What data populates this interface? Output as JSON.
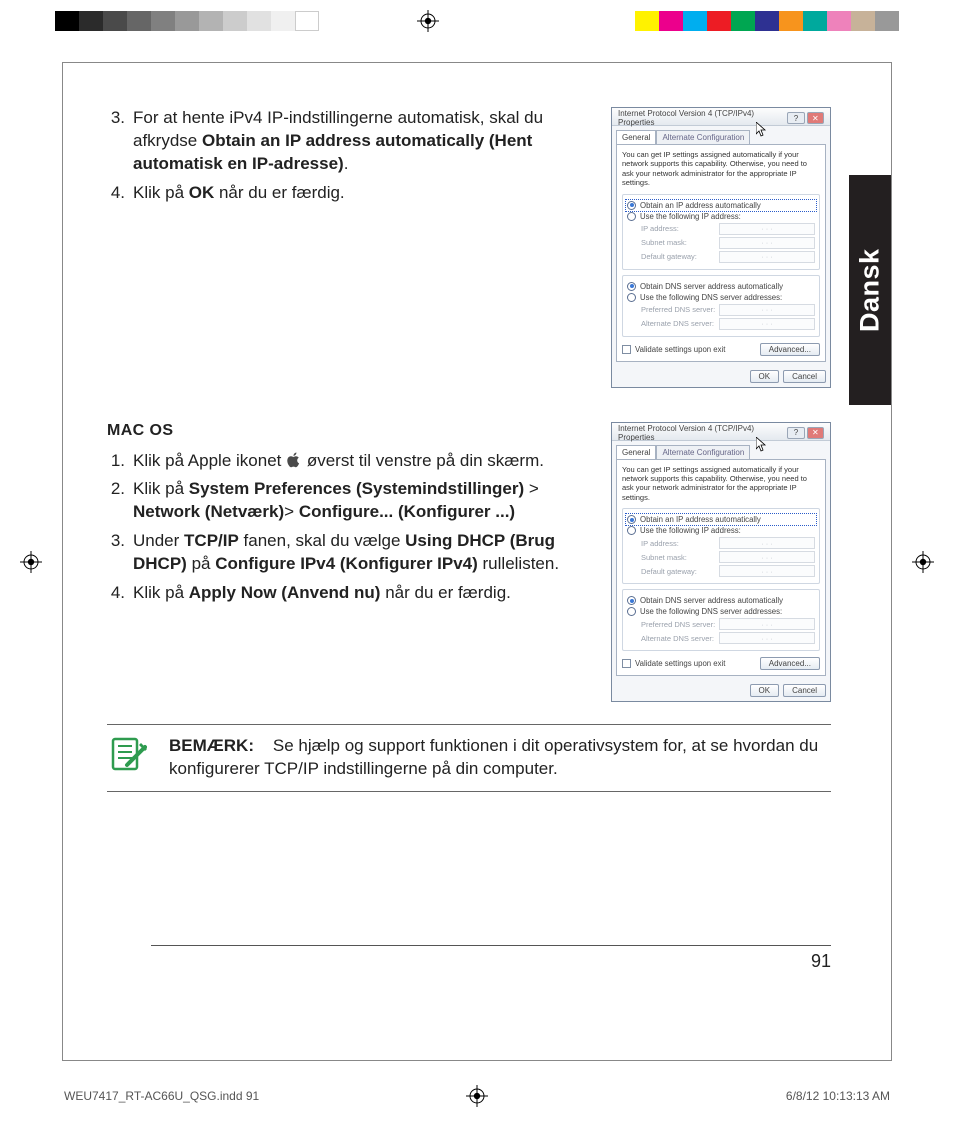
{
  "language_tab": "Dansk",
  "page_number": "91",
  "slug": {
    "file": "WEU7417_RT-AC66U_QSG.indd   91",
    "stamp": "6/8/12   10:13:13 AM"
  },
  "windows_section": {
    "items": [
      {
        "num": "3.",
        "pre": "For at hente iPv4 IP-indstillingerne automatisk, skal du afkrydse ",
        "b1": "Obtain an IP address automatically (Hent automatisk en IP-adresse)",
        "post": "."
      },
      {
        "num": "4.",
        "pre": "Klik på ",
        "b1": "OK",
        "post": " når du er færdig."
      }
    ]
  },
  "mac_section": {
    "heading": "MAC OS",
    "items": [
      {
        "num": "1.",
        "pre": "Klik på Apple ikonet ",
        "post": " øverst til venstre på din skærm."
      },
      {
        "num": "2.",
        "pre": "Klik på ",
        "b1": "System Preferences (Systemindstillinger)",
        "mid1": " > ",
        "b2": "Network (Netværk)",
        "mid2": "> ",
        "b3": "Configure... (Konfigurer ...)",
        "post": ""
      },
      {
        "num": "3.",
        "pre": "Under ",
        "b1": "TCP/IP",
        "mid1": " fanen, skal du vælge ",
        "b2": "Using DHCP (Brug DHCP)",
        "mid2": " på ",
        "b3": "Configure IPv4 (Konfigurer IPv4)",
        "post": " rullelisten."
      },
      {
        "num": "4.",
        "pre": "Klik på ",
        "b1": "Apply Now (Anvend nu)",
        "post": " når du er færdig."
      }
    ]
  },
  "note": {
    "label": "BEMÆRK:",
    "text": "Se hjælp og support funktionen i dit operativsystem for, at se hvordan du konfigurerer TCP/IP indstillingerne på din computer."
  },
  "dialog": {
    "title": "Internet Protocol Version 4 (TCP/IPv4) Properties",
    "tabs": [
      "General",
      "Alternate Configuration"
    ],
    "info": "You can get IP settings assigned automatically if your network supports this capability. Otherwise, you need to ask your network administrator for the appropriate IP settings.",
    "r1a": "Obtain an IP address automatically",
    "r1b": "Use the following IP address:",
    "f1": "IP address:",
    "f2": "Subnet mask:",
    "f3": "Default gateway:",
    "r2a": "Obtain DNS server address automatically",
    "r2b": "Use the following DNS server addresses:",
    "f4": "Preferred DNS server:",
    "f5": "Alternate DNS server:",
    "chk": "Validate settings upon exit",
    "adv": "Advanced...",
    "ok": "OK",
    "cancel": "Cancel"
  },
  "colorbar": {
    "left": [
      "#000000",
      "#2b2b2b",
      "#4a4a4a",
      "#666666",
      "#808080",
      "#999999",
      "#b3b3b3",
      "#cccccc",
      "#e1e1e1",
      "#f0f0f0",
      "#ffffff"
    ],
    "right": [
      "#fff200",
      "#ec008c",
      "#00aeef",
      "#ed1c24",
      "#00a651",
      "#2e3192",
      "#f7941d",
      "#00a99d",
      "#ee82bb",
      "#c7b299",
      "#999999"
    ]
  }
}
